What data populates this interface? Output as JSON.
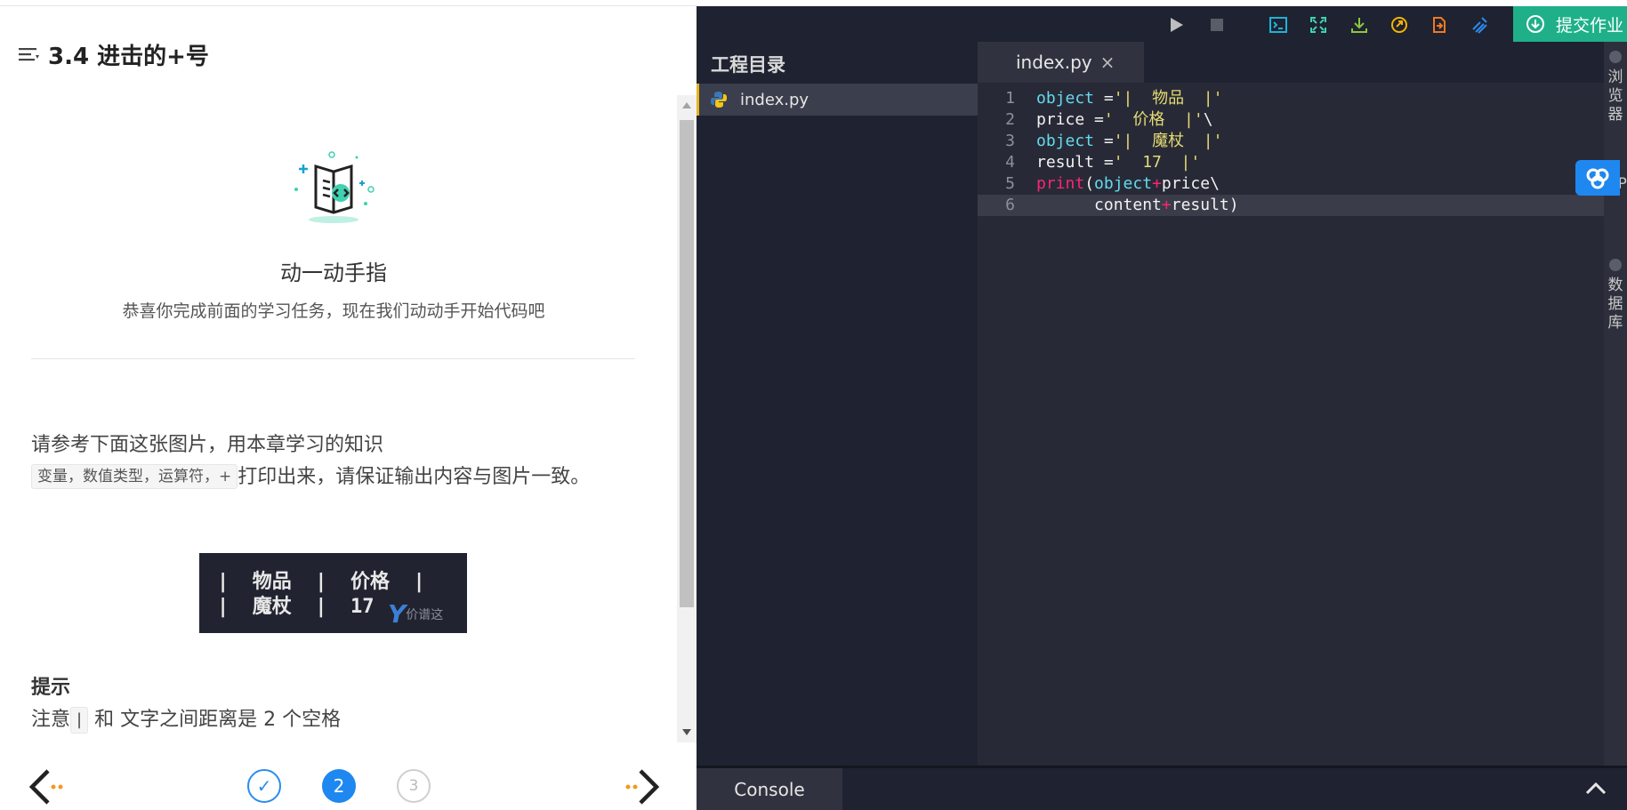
{
  "lesson": {
    "title": "3.4 进击的+号",
    "hero_title": "动一动手指",
    "hero_subtitle": "恭喜你完成前面的学习任务，现在我们动动手开始代码吧",
    "instruction_before": "请参考下面这张图片，用本章学习的知识",
    "instruction_chip": "变量，数值类型，运算符，+",
    "instruction_after": "打印出来，请保证输出内容与图片一致。",
    "sample_row1": "|  物品  |  价格  |",
    "sample_row2": "|  魔杖  |  17",
    "sample_watermark": "价谱这",
    "hint_title": "提示",
    "hint_before": "注意",
    "hint_chip": "|",
    "hint_after": " 和 文字之间距离是 2 个空格",
    "steps": [
      "✓",
      "2",
      "3"
    ]
  },
  "ide": {
    "submit_label": "提交作业",
    "tree_title": "工程目录",
    "file_name": "index.py",
    "tab_label": "index.py",
    "tab_close": "×",
    "console_label": "Console",
    "side_panels": [
      "浏览器",
      "API",
      "数据库"
    ],
    "code_lines": [
      {
        "n": "1",
        "code": "object ='|  物品  |'"
      },
      {
        "n": "2",
        "code": "price ='  价格  |'\\"
      },
      {
        "n": "3",
        "code": "object ='|  魔杖  |'"
      },
      {
        "n": "4",
        "code": "result ='  17  |'"
      },
      {
        "n": "5",
        "code": "print(object+price\\"
      },
      {
        "n": "6",
        "code": "      content+result)"
      }
    ]
  },
  "colors": {
    "accent_blue": "#1e88f0",
    "submit_green": "#1fb08a",
    "ide_bg": "#272a36",
    "string_yellow": "#e6db74",
    "keyword_cyan": "#66d9ef",
    "operator_pink": "#f92672"
  },
  "icons": [
    "list-menu-icon",
    "book-code-icon",
    "run-icon",
    "stop-icon",
    "terminal-icon",
    "fullscreen-icon",
    "download-icon",
    "refresh-icon",
    "share-icon",
    "clean-icon",
    "upload-icon",
    "python-file-icon",
    "cloud-icon",
    "prev-arrow-icon",
    "next-arrow-icon",
    "chevron-up-icon"
  ]
}
